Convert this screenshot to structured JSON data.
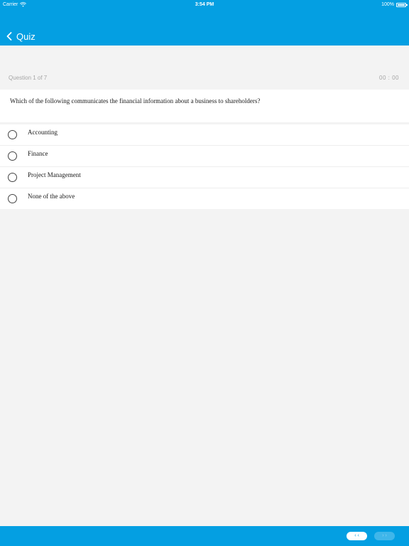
{
  "status_bar": {
    "carrier": "Carrier",
    "time": "3:54 PM",
    "battery": "100%",
    "icons": {
      "wifi": "wifi-icon",
      "battery": "battery-icon"
    }
  },
  "nav": {
    "back_icon": "chevron-left-icon",
    "title": "Quiz"
  },
  "quiz": {
    "progress": "Question 1 of 7",
    "timer": "00 : 00",
    "question": "Which of the following communicates the financial information about a business to shareholders?",
    "options": [
      {
        "label": "Accounting",
        "selected": false
      },
      {
        "label": "Finance",
        "selected": false
      },
      {
        "label": "Project Management",
        "selected": false
      },
      {
        "label": "None of the above",
        "selected": false
      }
    ]
  },
  "footer": {
    "prev_label": "‹ ‹",
    "next_label": "› ›"
  },
  "colors": {
    "accent": "#049fe2",
    "background": "#f3f3f3",
    "card": "#ffffff",
    "muted_text": "#a6a6a6"
  }
}
